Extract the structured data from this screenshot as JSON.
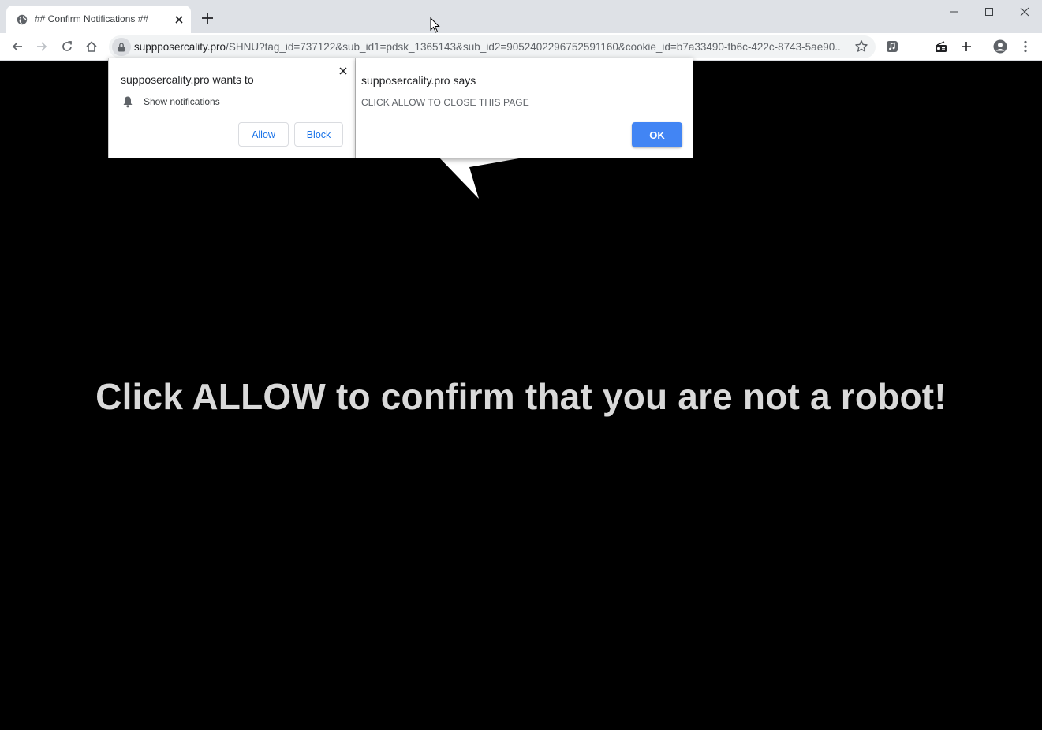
{
  "tab": {
    "title": "## Confirm Notifications ##"
  },
  "toolbar": {
    "url_host": "suppposercality.pro",
    "url_path": "/SHNU?tag_id=737122&sub_id1=pdsk_1365143&sub_id2=9052402296752591160&cookie_id=b7a33490-fb6c-422c-8743-5ae90..."
  },
  "permission_prompt": {
    "title": "supposercality.pro wants to",
    "item": "Show notifications",
    "allow_label": "Allow",
    "block_label": "Block"
  },
  "alert_dialog": {
    "title": "supposercality.pro says",
    "message": "CLICK ALLOW TO CLOSE THIS PAGE",
    "ok_label": "OK"
  },
  "page": {
    "headline": "Click ALLOW to confirm that you are not a robot!"
  },
  "colors": {
    "accent": "#4285f4",
    "link_blue": "#1a73e8",
    "page_bg": "#000000",
    "headline": "#d9d9d9"
  }
}
